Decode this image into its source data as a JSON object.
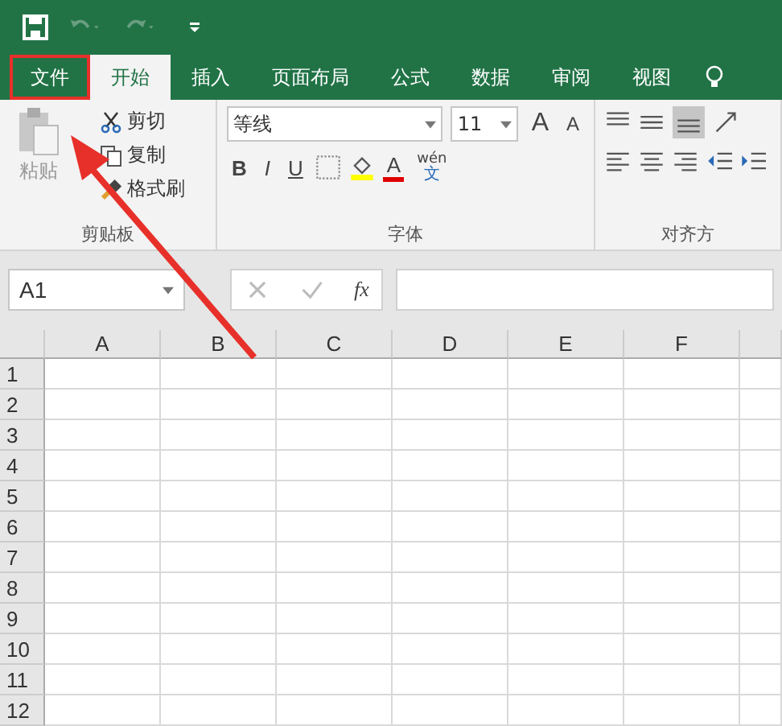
{
  "tabs": [
    {
      "label": "文件",
      "selected": false,
      "highlighted": true
    },
    {
      "label": "开始",
      "selected": true,
      "highlighted": false
    },
    {
      "label": "插入",
      "selected": false,
      "highlighted": false
    },
    {
      "label": "页面布局",
      "selected": false,
      "highlighted": false
    },
    {
      "label": "公式",
      "selected": false,
      "highlighted": false
    },
    {
      "label": "数据",
      "selected": false,
      "highlighted": false
    },
    {
      "label": "审阅",
      "selected": false,
      "highlighted": false
    },
    {
      "label": "视图",
      "selected": false,
      "highlighted": false
    }
  ],
  "clipboard": {
    "paste": "粘贴",
    "cut": "剪切",
    "copy": "复制",
    "painter": "格式刷",
    "label": "剪贴板"
  },
  "font": {
    "name": "等线",
    "size": "11",
    "grow": "A",
    "shrink": "A",
    "bold": "B",
    "italic": "I",
    "underline": "U",
    "color_letter": "A",
    "phonetic_top": "wén",
    "phonetic_bottom": "文",
    "label": "字体"
  },
  "alignment": {
    "label": "对齐方"
  },
  "formula_bar": {
    "name_box": "A1",
    "fx": "fx"
  },
  "columns": [
    "A",
    "B",
    "C",
    "D",
    "E",
    "F"
  ],
  "rows": [
    "1",
    "2",
    "3",
    "4",
    "5",
    "6",
    "7",
    "8",
    "9",
    "10",
    "11",
    "12"
  ]
}
